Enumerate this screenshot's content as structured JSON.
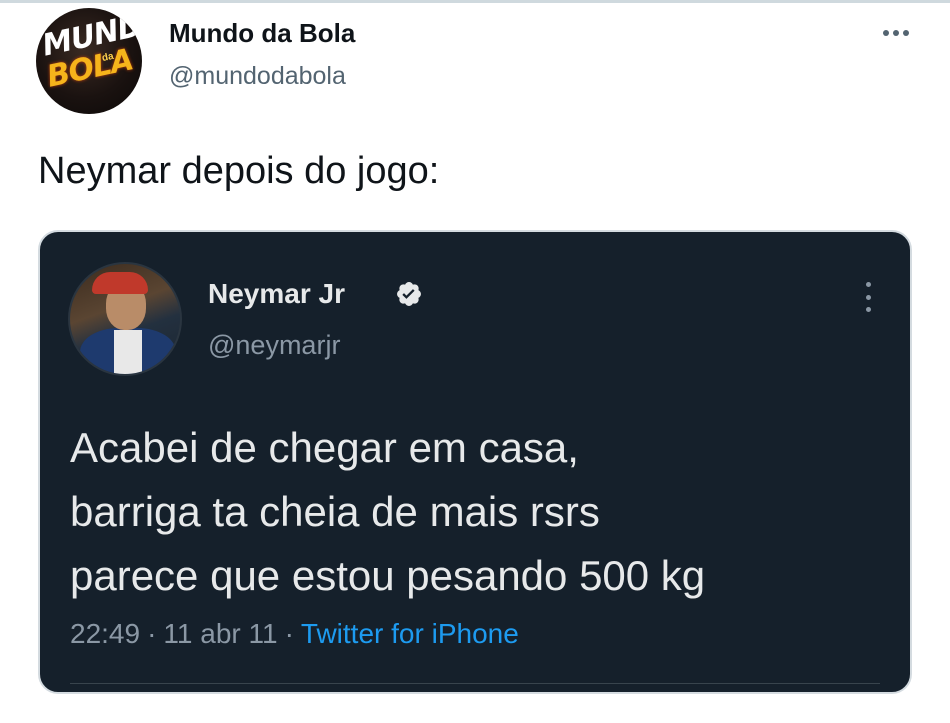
{
  "outer_tweet": {
    "author": {
      "name": "Mundo da Bola",
      "handle": "@mundodabola",
      "avatar_icon": "mundo-da-bola-logo",
      "avatar_text": {
        "top": "MUNDO",
        "middle": "da",
        "bottom": "BOLA"
      }
    },
    "text": "Neymar depois do jogo:",
    "menu_icon": "more-horizontal-icon"
  },
  "quoted_tweet": {
    "author": {
      "name": "Neymar Jr",
      "handle": "@neymarjr",
      "verified": true,
      "avatar_icon": "user-avatar-photo"
    },
    "text": "Acabei de chegar em casa,\nbarriga ta cheia de mais rsrs\nparece que estou pesando 500 kg",
    "time": "22:49",
    "date": "11 abr 11",
    "separator": "·",
    "source": "Twitter for iPhone",
    "menu_icon": "more-vertical-icon"
  },
  "colors": {
    "dark_card_bg": "#15202b",
    "primary_text_light": "#e7e9ea",
    "secondary_text": "#8b98a5",
    "link_blue": "#1d9bf0",
    "handle_gray": "#536471"
  }
}
